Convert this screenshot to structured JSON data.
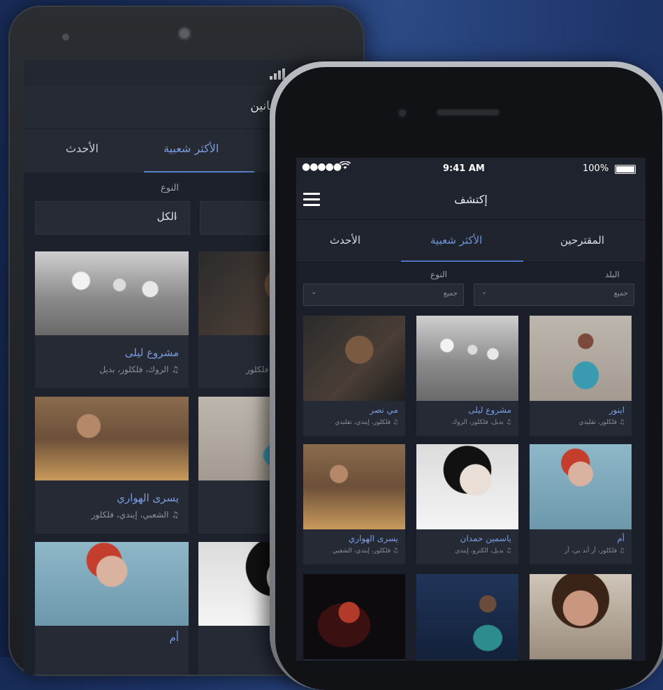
{
  "android": {
    "header_title": "الفنانين",
    "tabs": [
      "الأحدث",
      "الأكثر شعبية"
    ],
    "filter_label": "النوع",
    "filter_value": "الكل",
    "cards": [
      {
        "name": "مشروع ليلى",
        "tags": "الروك، فلكلور، بديل"
      },
      {
        "name": "",
        "tags": "فلكلور"
      },
      {
        "name": "يسرى الهواري",
        "tags": "الشعبي، إيندي، فلكلور"
      },
      {
        "name": "",
        "tags": ""
      },
      {
        "name": "أم",
        "tags": ""
      },
      {
        "name": "",
        "tags": ""
      }
    ]
  },
  "iphone": {
    "status": {
      "time": "9:41 AM",
      "battery": "100%",
      "dots": "●●●●●"
    },
    "header_title": "إكتشف",
    "tabs": {
      "newest": "الأحدث",
      "popular": "الأكثر شعبية",
      "suggested": "المقترحين"
    },
    "filters": {
      "country_label": "البلد",
      "country_value": "جميع",
      "genre_label": "النوع",
      "genre_value": "جميع"
    },
    "cards": [
      {
        "name": "مي نصر",
        "tags": "فلكلور، إيندي، تقليدي"
      },
      {
        "name": "مشروع ليلى",
        "tags": "بديل، فلكلور، الروك"
      },
      {
        "name": "اينور",
        "tags": "فلكلور، تقليدي"
      },
      {
        "name": "يسرى الهواري",
        "tags": "فلكلور، إيندي، الشعبي"
      },
      {
        "name": "ياسمين حمدان",
        "tags": "بديل، الكترو، إيندي"
      },
      {
        "name": "أم",
        "tags": "فلكلور، أر أند بي، آر"
      },
      {
        "name": "",
        "tags": ""
      },
      {
        "name": "",
        "tags": ""
      },
      {
        "name": "",
        "tags": ""
      }
    ]
  },
  "icons": {
    "menu": "hamburger-icon",
    "wifi": "wifi-icon",
    "music": "music-note-icon",
    "chevron": "chevron-down-icon",
    "signal": "signal-icon"
  },
  "colors": {
    "accent": "#7a9be0",
    "background": "#1b1f29",
    "card": "#252a35"
  }
}
